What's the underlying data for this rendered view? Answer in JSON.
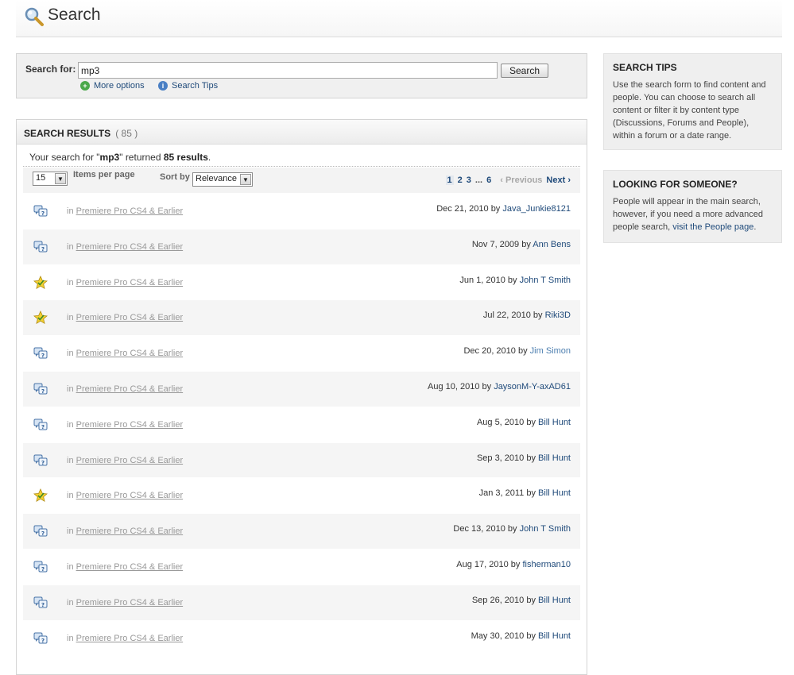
{
  "header": {
    "title": "Search"
  },
  "search": {
    "label": "Search for:",
    "value": "mp3",
    "button": "Search",
    "more_options": "More options",
    "search_tips": "Search Tips"
  },
  "results": {
    "title": "SEARCH RESULTS",
    "count": "( 85 )",
    "summary_prefix": "Your search for \"",
    "summary_query": "mp3",
    "summary_mid": "\" returned ",
    "summary_total": "85 results",
    "summary_end": ".",
    "per_page_value": "15",
    "per_page_label": "Items per page",
    "sort_label": "Sort by",
    "sort_value": "Relevance",
    "pager": {
      "pages": [
        "1",
        "2",
        "3"
      ],
      "ellipsis": "...",
      "last": "6",
      "previous": "Previous",
      "next": "Next"
    },
    "in_label": "in",
    "by_label": "by",
    "rows": [
      {
        "icon": "question-thread-icon",
        "forum": "Premiere Pro CS4 & Earlier",
        "date": "Dec 21, 2010",
        "author": "Java_Junkie8121"
      },
      {
        "icon": "question-thread-icon",
        "forum": "Premiere Pro CS4 & Earlier",
        "date": "Nov 7, 2009",
        "author": "Ann Bens"
      },
      {
        "icon": "answered-star-icon",
        "forum": "Premiere Pro CS4 & Earlier",
        "date": "Jun 1, 2010",
        "author": "John T Smith"
      },
      {
        "icon": "answered-star-icon",
        "forum": "Premiere Pro CS4 & Earlier",
        "date": "Jul 22, 2010",
        "author": "Riki3D"
      },
      {
        "icon": "question-thread-icon",
        "forum": "Premiere Pro CS4 & Earlier",
        "date": "Dec 20, 2010",
        "author": "Jim Simon"
      },
      {
        "icon": "question-thread-icon",
        "forum": "Premiere Pro CS4 & Earlier",
        "date": "Aug 10, 2010",
        "author": "JaysonM-Y-axAD61"
      },
      {
        "icon": "question-thread-icon",
        "forum": "Premiere Pro CS4 & Earlier",
        "date": "Aug 5, 2010",
        "author": "Bill Hunt"
      },
      {
        "icon": "question-thread-icon",
        "forum": "Premiere Pro CS4 & Earlier",
        "date": "Sep 3, 2010",
        "author": "Bill Hunt"
      },
      {
        "icon": "answered-star-icon",
        "forum": "Premiere Pro CS4 & Earlier",
        "date": "Jan 3, 2011",
        "author": "Bill Hunt"
      },
      {
        "icon": "question-thread-icon",
        "forum": "Premiere Pro CS4 & Earlier",
        "date": "Dec 13, 2010",
        "author": "John T Smith"
      },
      {
        "icon": "question-thread-icon",
        "forum": "Premiere Pro CS4 & Earlier",
        "date": "Aug 17, 2010",
        "author": "fisherman10"
      },
      {
        "icon": "question-thread-icon",
        "forum": "Premiere Pro CS4 & Earlier",
        "date": "Sep 26, 2010",
        "author": "Bill Hunt"
      },
      {
        "icon": "question-thread-icon",
        "forum": "Premiere Pro CS4 & Earlier",
        "date": "May 30, 2010",
        "author": "Bill Hunt"
      }
    ]
  },
  "sidebar": {
    "tips_title": "SEARCH TIPS",
    "tips_text": "Use the search form to find content and people. You can choose to search all content or filter it by content type (Discussions, Forums and People), within a forum or a date range.",
    "someone_title": "LOOKING FOR SOMEONE?",
    "someone_text": "People will appear in the main search, however, if you need a more advanced people search, ",
    "someone_link": "visit the People page",
    "someone_end": "."
  },
  "colors": {
    "link": "#1f4a7a",
    "panel_bg": "#f0f0f0",
    "row_alt": "#f5f5f5",
    "muted": "#999999"
  }
}
